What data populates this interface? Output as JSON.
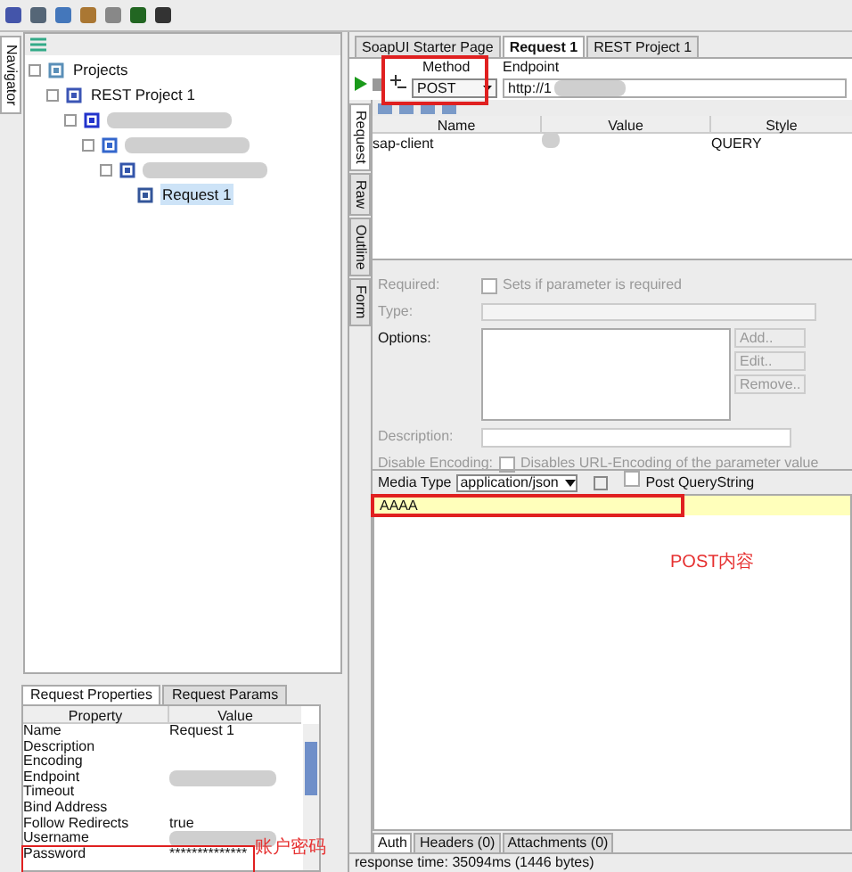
{
  "navigator": {
    "tab": "Navigator",
    "tree": [
      {
        "label": "Projects",
        "children": [
          {
            "label": "REST Project 1",
            "children": [
              {
                "children": [
                  {
                    "children": [
                      {
                        "children": [
                          {
                            "label": "Request 1",
                            "selected": true
                          }
                        ]
                      }
                    ]
                  }
                ]
              }
            ]
          }
        ]
      }
    ]
  },
  "properties": {
    "tabs": [
      {
        "label": "Request Properties",
        "selected": true
      },
      {
        "label": "Request Params",
        "selected": false
      }
    ],
    "columns": [
      "Property",
      "Value"
    ],
    "rows": [
      {
        "kind": "text",
        "property": "Name",
        "value": "Request 1"
      },
      {
        "kind": "text",
        "property": "Description"
      },
      {
        "kind": "text",
        "property": "Encoding"
      },
      {
        "kind": "blurred",
        "property": "Endpoint"
      },
      {
        "kind": "text",
        "property": "Timeout"
      },
      {
        "kind": "text",
        "property": "Bind Address"
      },
      {
        "kind": "text",
        "property": "Follow Redirects",
        "value": "true"
      },
      {
        "kind": "blurred",
        "property": "Username"
      },
      {
        "kind": "text",
        "property": "Password",
        "value": "**************"
      }
    ]
  },
  "editor_tabs": [
    {
      "label": "SoapUI Starter Page",
      "selected": false
    },
    {
      "label": "Request 1",
      "selected": true
    },
    {
      "label": "REST Project 1",
      "selected": false
    }
  ],
  "request": {
    "method_label": "Method",
    "method": "POST",
    "endpoint_label": "Endpoint",
    "endpoint": "http://1",
    "side_tabs": [
      {
        "label": "Request",
        "selected": true
      },
      {
        "label": "Raw",
        "selected": false
      },
      {
        "label": "Outline",
        "selected": false
      },
      {
        "label": "Form",
        "selected": false
      }
    ],
    "params": {
      "columns": [
        "Name",
        "Value",
        "Style"
      ],
      "rows": [
        {
          "name": "sap-client",
          "style": "QUERY"
        }
      ]
    },
    "form": {
      "required_label": "Required:",
      "required_text": "Sets if parameter is required",
      "required_checked": false,
      "type_label": "Type:",
      "options_label": "Options:",
      "buttons": [
        "Add..",
        "Edit..",
        "Remove.."
      ],
      "description_label": "Description:",
      "encoding_label": "Disable Encoding:",
      "encoding_text": "Disables URL-Encoding of the parameter value",
      "encoding_checked": false
    },
    "media_type_label": "Media Type",
    "media_type": "application/json",
    "post_querystring": "Post QueryString",
    "post_querystring_checked": false,
    "body": "AAAA"
  },
  "bottom_tabs": [
    {
      "label": "Auth",
      "selected": true
    },
    {
      "label": "Headers (0)",
      "selected": false
    },
    {
      "label": "Attachments (0)",
      "selected": false
    }
  ],
  "status": "response time: 35094ms (1446 bytes)",
  "annotations": [
    {
      "text": "POST内容"
    },
    {
      "text": "账户密码"
    }
  ]
}
